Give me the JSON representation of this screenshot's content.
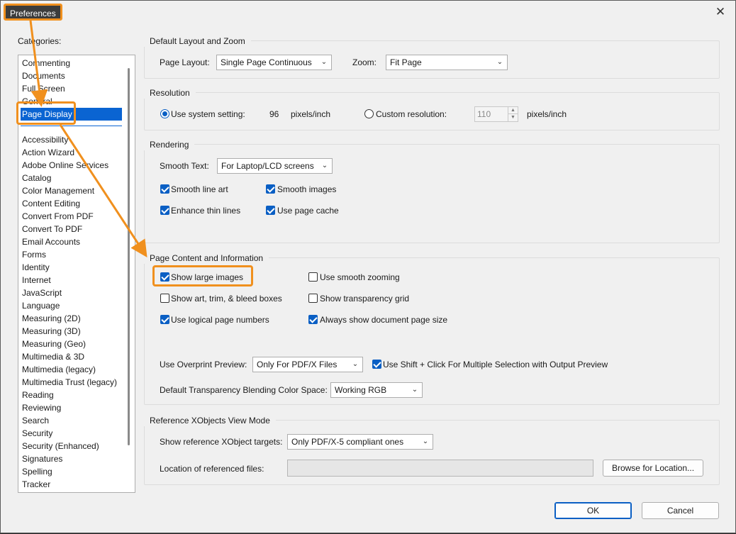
{
  "window": {
    "title": "Preferences"
  },
  "colors": {
    "accent": "#0a64d2",
    "annotation": "#f0901e"
  },
  "icons": {
    "close": "close-icon",
    "dropdown": "chevron-down-icon",
    "check": "checkmark-icon"
  },
  "sidebar": {
    "label": "Categories:",
    "top_items": [
      "Commenting",
      "Documents",
      "Full Screen",
      "General",
      "Page Display"
    ],
    "selected": "Page Display",
    "items": [
      "Accessibility",
      "Action Wizard",
      "Adobe Online Services",
      "Catalog",
      "Color Management",
      "Content Editing",
      "Convert From PDF",
      "Convert To PDF",
      "Email Accounts",
      "Forms",
      "Identity",
      "Internet",
      "JavaScript",
      "Language",
      "Measuring (2D)",
      "Measuring (3D)",
      "Measuring (Geo)",
      "Multimedia & 3D",
      "Multimedia (legacy)",
      "Multimedia Trust (legacy)",
      "Reading",
      "Reviewing",
      "Search",
      "Security",
      "Security (Enhanced)",
      "Signatures",
      "Spelling",
      "Tracker"
    ]
  },
  "layout_zoom": {
    "title": "Default Layout and Zoom",
    "page_layout_label": "Page Layout:",
    "page_layout_value": "Single Page Continuous",
    "zoom_label": "Zoom:",
    "zoom_value": "Fit Page"
  },
  "resolution": {
    "title": "Resolution",
    "system_label": "Use system setting:",
    "system_value": "96",
    "unit1": "pixels/inch",
    "custom_label": "Custom resolution:",
    "custom_value": "110",
    "unit2": "pixels/inch",
    "use_system": true
  },
  "rendering": {
    "title": "Rendering",
    "smooth_text_label": "Smooth Text:",
    "smooth_text_value": "For Laptop/LCD screens",
    "checkboxes": [
      {
        "label": "Smooth line art",
        "checked": true
      },
      {
        "label": "Smooth images",
        "checked": true
      },
      {
        "label": "Enhance thin lines",
        "checked": true
      },
      {
        "label": "Use page cache",
        "checked": true
      }
    ]
  },
  "page_content": {
    "title": "Page Content and Information",
    "checkboxes": [
      {
        "label": "Show large images",
        "checked": true
      },
      {
        "label": "Use smooth zooming",
        "checked": false
      },
      {
        "label": "Show art, trim, & bleed boxes",
        "checked": false
      },
      {
        "label": "Show transparency grid",
        "checked": false
      },
      {
        "label": "Use logical page numbers",
        "checked": true
      },
      {
        "label": "Always show document page size",
        "checked": true
      }
    ],
    "overprint_label": "Use Overprint Preview:",
    "overprint_value": "Only For PDF/X Files",
    "shift_click_label": "Use Shift + Click For Multiple Selection with Output Preview",
    "shift_click_checked": true,
    "blending_label": "Default Transparency Blending Color Space:",
    "blending_value": "Working RGB"
  },
  "xobjects": {
    "title": "Reference XObjects View Mode",
    "targets_label": "Show reference XObject targets:",
    "targets_value": "Only PDF/X-5 compliant ones",
    "location_label": "Location of referenced files:",
    "location_value": "",
    "browse_label": "Browse for Location..."
  },
  "footer": {
    "ok_label": "OK",
    "cancel_label": "Cancel"
  }
}
